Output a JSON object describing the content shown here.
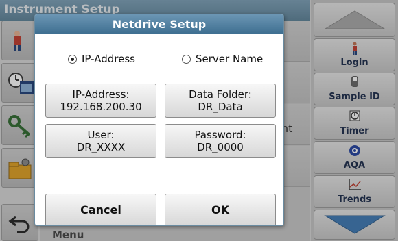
{
  "background": {
    "title": "Instrument Setup",
    "fragment_text": "nt",
    "menu_text": "Menu"
  },
  "dialog": {
    "title": "Netdrive Setup",
    "radio_ip": "IP-Address",
    "radio_server": "Server Name",
    "selected": "IP-Address",
    "ip_label": "IP-Address:",
    "ip_value": "192.168.200.30",
    "folder_label": "Data Folder:",
    "folder_value": "DR_Data",
    "user_label": "User:",
    "user_value": "DR_XXXX",
    "password_label": "Password:",
    "password_value": "DR_0000",
    "cancel_label": "Cancel",
    "ok_label": "OK"
  },
  "right_panel": {
    "login": "Login",
    "sample_id": "Sample ID",
    "timer": "Timer",
    "aqa": "AQA",
    "trends": "Trends"
  },
  "colors": {
    "dialog_title_bar": "#4f7ea0",
    "accent_blue": "#3c78b4"
  }
}
